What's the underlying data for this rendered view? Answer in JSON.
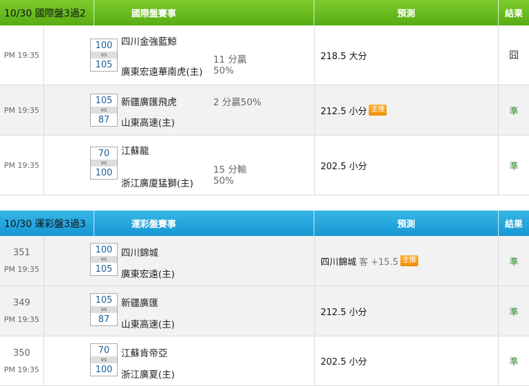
{
  "sections": [
    {
      "date": "10/30 國際盤3過2",
      "title": "國際盤賽事",
      "pred_header": "預測",
      "result_header": "結果",
      "rows": [
        {
          "num": "",
          "time": "PM 19:35",
          "score_top": "100",
          "vs": "vs",
          "score_bottom": "105",
          "team_top": "四川金強藍鯨",
          "team_bottom": "廣東宏遠華南虎(主)",
          "hand_top": "11 分贏",
          "hand_bottom": "50%",
          "pick": "218.5 大分",
          "pick_extra": "",
          "tag": "",
          "result": "囧"
        },
        {
          "num": "",
          "time": "PM 19:35",
          "score_top": "105",
          "vs": "vs",
          "score_bottom": "87",
          "team_top": "新疆廣匯飛虎",
          "team_bottom": "山東高速(主)",
          "hand_top": "2 分贏50%",
          "hand_bottom": "",
          "pick": "212.5 小分",
          "pick_extra": "",
          "tag": "主推",
          "result": "準"
        },
        {
          "num": "",
          "time": "PM 19:35",
          "score_top": "70",
          "vs": "vs",
          "score_bottom": "100",
          "team_top": "江蘇龍",
          "team_bottom": "浙江廣廈猛獅(主)",
          "hand_top": "15 分輸",
          "hand_bottom": "50%",
          "pick": "202.5 小分",
          "pick_extra": "",
          "tag": "",
          "result": "準"
        }
      ]
    },
    {
      "date": "10/30 運彩盤3過3",
      "title": "運彩盤賽事",
      "pred_header": "預測",
      "result_header": "結果",
      "rows": [
        {
          "num": "351",
          "time": "PM 19:35",
          "score_top": "100",
          "vs": "vs",
          "score_bottom": "105",
          "team_top": "四川錦城",
          "team_bottom": "廣東宏遠(主)",
          "hand_top": "",
          "hand_bottom": "",
          "pick": "四川錦城",
          "pick_extra": "客 +15.5",
          "tag": "主推",
          "result": "準"
        },
        {
          "num": "349",
          "time": "PM 19:35",
          "score_top": "105",
          "vs": "vs",
          "score_bottom": "87",
          "team_top": "新疆廣匯",
          "team_bottom": "山東高速(主)",
          "hand_top": "",
          "hand_bottom": "",
          "pick": "212.5 小分",
          "pick_extra": "",
          "tag": "",
          "result": "準"
        },
        {
          "num": "350",
          "time": "PM 19:35",
          "score_top": "70",
          "vs": "vs",
          "score_bottom": "100",
          "team_top": "江蘇肯帝亞",
          "team_bottom": "浙江廣夏(主)",
          "hand_top": "",
          "hand_bottom": "",
          "pick": "202.5 小分",
          "pick_extra": "",
          "tag": "",
          "result": "準"
        }
      ]
    }
  ]
}
